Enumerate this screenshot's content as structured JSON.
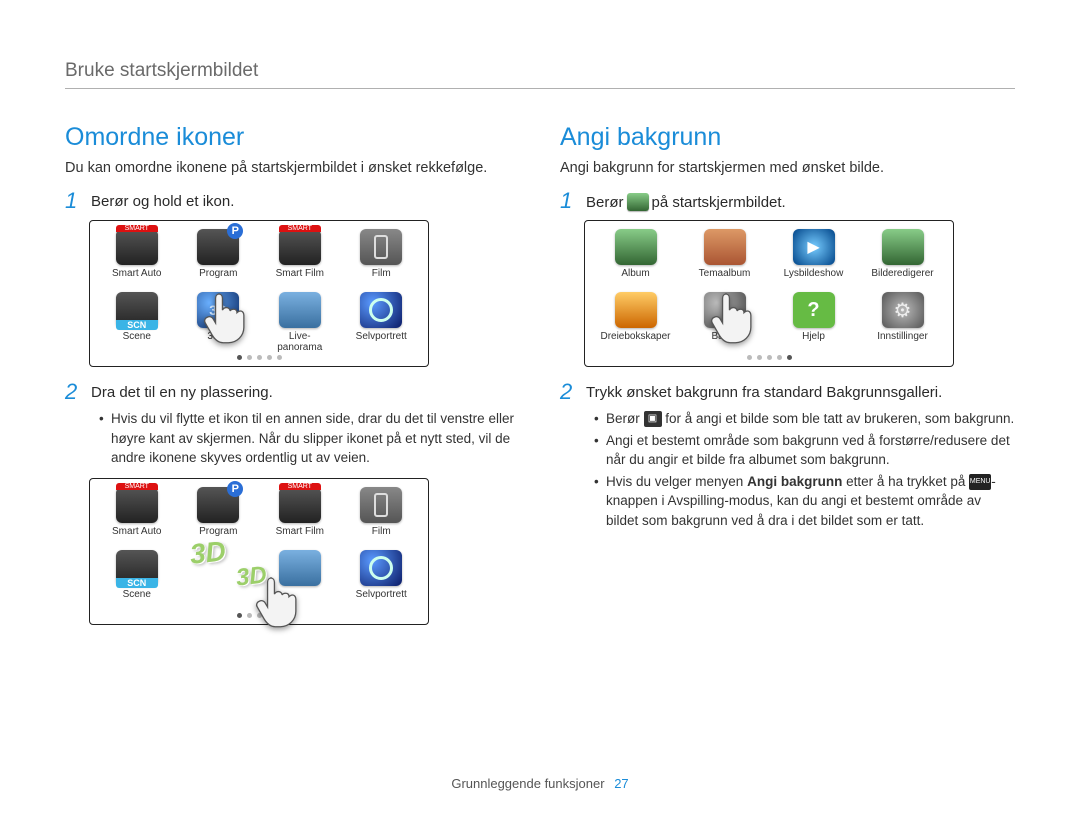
{
  "header": "Bruke startskjermbildet",
  "left": {
    "title": "Omordne ikoner",
    "intro": "Du kan omordne ikonene på startskjermbildet i ønsket rekkefølge.",
    "step1_num": "1",
    "step1": "Berør og hold et ikon.",
    "step2_num": "2",
    "step2": "Dra det til en ny plassering.",
    "bullet1": "Hvis du vil flytte et ikon til en annen side, drar du det til venstre eller høyre kant av skjermen. Når du slipper ikonet på et nytt sted, vil de andre ikonene skyves ordentlig ut av veien.",
    "grid1": {
      "r1": [
        "Smart Auto",
        "Program",
        "Smart Film",
        "Film"
      ],
      "r2": [
        "Scene",
        "3D-b",
        "Live-\npanorama",
        "Selvportrett"
      ]
    },
    "grid2": {
      "r1": [
        "Smart Auto",
        "Program",
        "Smart Film",
        "Film"
      ],
      "r2": [
        "Scene",
        "",
        "",
        "Selvportrett"
      ]
    }
  },
  "right": {
    "title": "Angi bakgrunn",
    "intro": "Angi bakgrunn for startskjermen med ønsket bilde.",
    "step1_num": "1",
    "step1_before": "Berør",
    "step1_after": "på startskjermbildet.",
    "step2_num": "2",
    "step2": "Trykk ønsket bakgrunn fra standard Bakgrunnsgalleri.",
    "bullet1_before": "Berør",
    "bullet1_after": "for å angi et bilde som ble tatt av brukeren, som bakgrunn.",
    "bullet2": "Angi et bestemt område som bakgrunn ved å forstørre/redusere det når du angir et bilde fra albumet som bakgrunn.",
    "bullet3_before": "Hvis du velger menyen",
    "bullet3_bold": "Angi bakgrunn",
    "bullet3_mid": "etter å ha trykket på",
    "bullet3_after": "-knappen i Avspilling-modus, kan du angi et bestemt område av bildet som bakgrunn ved å dra i det bildet som er tatt.",
    "grid": {
      "r1": [
        "Album",
        "Temaalbum",
        "Lysbildeshow",
        "Bilderedigerer"
      ],
      "r2": [
        "Dreiebokskaper",
        "Bakgr",
        "Hjelp",
        "Innstillinger"
      ]
    }
  },
  "inline_menu_label": "MENU",
  "footer": {
    "text": "Grunnleggende funksjoner",
    "page": "27"
  }
}
